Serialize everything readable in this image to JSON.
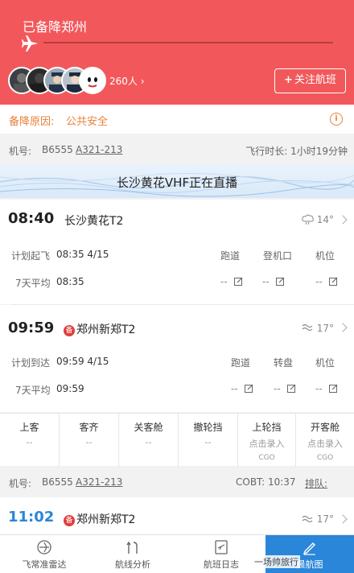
{
  "header": {
    "status": "已备降郑州",
    "avatar_count": "260人",
    "follow_button": "关注航班",
    "follow_plus": "+"
  },
  "divert": {
    "label": "备降原因:",
    "value": "公共安全",
    "info_icon": "i"
  },
  "aircraft": {
    "label": "机号:",
    "registration": "B6555",
    "type": "A321-213",
    "duration_label": "飞行时长:",
    "duration": "1小时19分钟"
  },
  "live": {
    "text": "长沙黄花VHF正在直播"
  },
  "departure": {
    "time": "08:40",
    "airport": "长沙黄花T2",
    "weather_icon": "cloud-rain-icon",
    "temp": "14°",
    "plan_label": "计划起飞",
    "plan_value": "08:35 4/15",
    "avg_label": "7天平均",
    "avg_value": "08:35",
    "col1": "跑道",
    "col2": "登机口",
    "col3": "机位",
    "dash": "--"
  },
  "arrival": {
    "time": "09:59",
    "badge": "备",
    "airport": "郑州新郑T2",
    "weather_icon": "haze-icon",
    "temp": "17°",
    "plan_label": "计划到达",
    "plan_value": "09:59 4/15",
    "avg_label": "7天平均",
    "avg_value": "09:59",
    "col1": "跑道",
    "col2": "转盘",
    "col3": "机位",
    "dash": "--"
  },
  "status_grid": [
    {
      "title": "上客",
      "value": "--"
    },
    {
      "title": "客齐",
      "value": "--"
    },
    {
      "title": "关客舱",
      "value": "--"
    },
    {
      "title": "撤轮挡",
      "value": "--"
    },
    {
      "title": "上轮挡",
      "value": "点击录入",
      "source": "CGO"
    },
    {
      "title": "开客舱",
      "value": "点击录入",
      "source": "CGO"
    }
  ],
  "aircraft2": {
    "label": "机号:",
    "registration": "B6555",
    "type": "A321-213",
    "cobt_label": "COBT:",
    "cobt": "10:37",
    "queue": "排队:"
  },
  "next_segment": {
    "time": "11:02",
    "badge": "备",
    "airport": "郑州新郑T2",
    "temp": "17°"
  },
  "nav": [
    {
      "label": "飞常准雷达"
    },
    {
      "label": "航线分析"
    },
    {
      "label": "航班日志"
    },
    {
      "label": "晨航图"
    }
  ],
  "watermark": "一场帅旅行",
  "colors": {
    "header": "#f2585b",
    "accent": "#e8823a",
    "blue": "#2a86d8",
    "badge": "#e23c3c"
  }
}
